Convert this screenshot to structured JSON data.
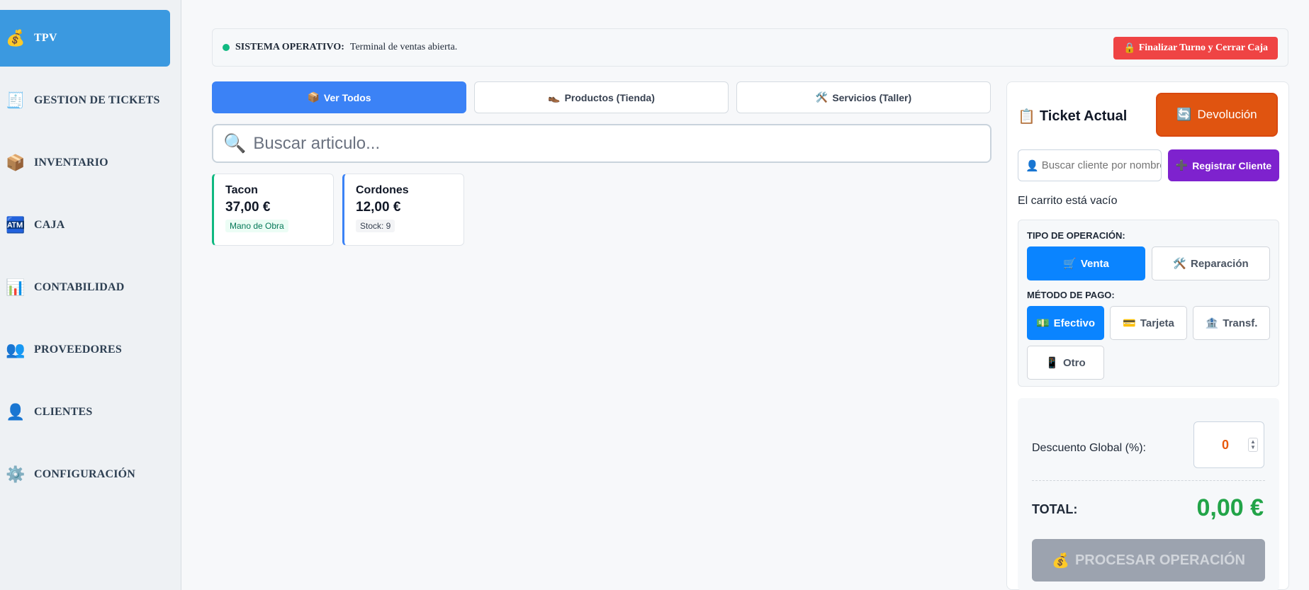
{
  "sidebar": {
    "items": [
      {
        "label": "TPV",
        "icon": "money-bag-icon",
        "glyph": "💰"
      },
      {
        "label": "GESTION DE TICKETS",
        "icon": "receipt-icon",
        "glyph": "🧾"
      },
      {
        "label": "INVENTARIO",
        "icon": "package-icon",
        "glyph": "📦"
      },
      {
        "label": "CAJA",
        "icon": "atm-icon",
        "glyph": "🏧"
      },
      {
        "label": "CONTABILIDAD",
        "icon": "bar-chart-icon",
        "glyph": "📊"
      },
      {
        "label": "PROVEEDORES",
        "icon": "users-icon",
        "glyph": "👥"
      },
      {
        "label": "CLIENTES",
        "icon": "user-icon",
        "glyph": "👤"
      },
      {
        "label": "CONFIGURACIÓN",
        "icon": "gear-icon",
        "glyph": "⚙️"
      }
    ]
  },
  "status": {
    "title": "SISTEMA OPERATIVO:",
    "text": "Terminal de ventas abierta.",
    "close_label": "Finalizar Turno y Cerrar Caja",
    "close_glyph": "🔒"
  },
  "tabs": [
    {
      "label": "Ver Todos",
      "glyph": "📦"
    },
    {
      "label": "Productos (Tienda)",
      "glyph": "👞"
    },
    {
      "label": "Servicios (Taller)",
      "glyph": "🛠️"
    }
  ],
  "search": {
    "placeholder": "Buscar articulo...",
    "glyph": "🔍"
  },
  "products": [
    {
      "name": "Tacon",
      "price": "37,00 €",
      "tag": "Mano de Obra"
    },
    {
      "name": "Cordones",
      "price": "12,00 €",
      "tag": "Stock: 9"
    }
  ],
  "ticket": {
    "title": "Ticket Actual",
    "title_glyph": "📋",
    "return_label": "Devolución",
    "return_glyph": "🔄",
    "client_placeholder": "Buscar cliente por nombre",
    "client_glyph": "👤",
    "register_label": "Registrar Cliente",
    "register_glyph": "➕",
    "empty_cart": "El carrito está vacío"
  },
  "operation": {
    "type_label": "TIPO DE OPERACIÓN:",
    "types": [
      {
        "label": "Venta",
        "glyph": "🛒"
      },
      {
        "label": "Reparación",
        "glyph": "🛠️"
      }
    ],
    "payment_label": "MÉTODO DE PAGO:",
    "payments": [
      {
        "label": "Efectivo",
        "glyph": "💵"
      },
      {
        "label": "Tarjeta",
        "glyph": "💳"
      },
      {
        "label": "Transf.",
        "glyph": "🏦"
      },
      {
        "label": "Otro",
        "glyph": "📱"
      }
    ]
  },
  "totals": {
    "discount_label": "Descuento Global (%):",
    "discount_value": "0",
    "total_label": "TOTAL:",
    "total_value": "0,00 €",
    "process_label": "PROCESAR OPERACIÓN",
    "process_glyph": "💰"
  },
  "colors": {
    "active_nav": "#3b99e0",
    "accent_blue": "#0a84ff",
    "return_orange": "#e05410",
    "register_purple": "#7e22ce",
    "close_red": "#ef4444",
    "total_green": "#22a448"
  }
}
